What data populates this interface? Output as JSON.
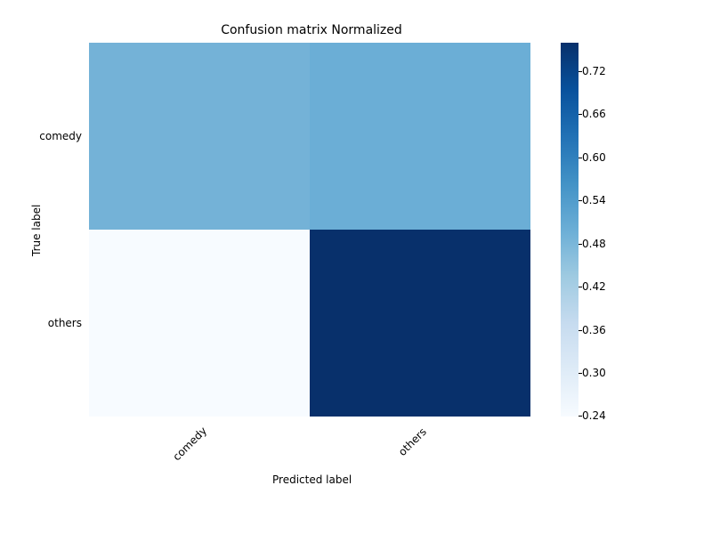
{
  "chart_data": {
    "type": "heatmap",
    "title": "Confusion matrix Normalized",
    "xlabel": "Predicted label",
    "ylabel": "True label",
    "x_categories": [
      "comedy",
      "others"
    ],
    "y_categories": [
      "comedy",
      "others"
    ],
    "values": [
      [
        0.49,
        0.51
      ],
      [
        0.24,
        0.76
      ]
    ],
    "colorbar_ticks": [
      "0.24",
      "0.30",
      "0.36",
      "0.42",
      "0.48",
      "0.54",
      "0.60",
      "0.66",
      "0.72"
    ],
    "vmin": 0.24,
    "vmax": 0.76
  },
  "cell_colors": {
    "c00": "#74b2d7",
    "c01": "#6baed6",
    "c10": "#f7fbff",
    "c11": "#08306b"
  },
  "colorbar_gradient": "linear-gradient(to top, #f7fbff 0%, #deebf7 12.5%, #c6dbef 25%, #9ecae1 37.5%, #6baed6 50%, #4292c6 62.5%, #2171b5 75%, #08519c 87.5%, #08306b 100%)"
}
